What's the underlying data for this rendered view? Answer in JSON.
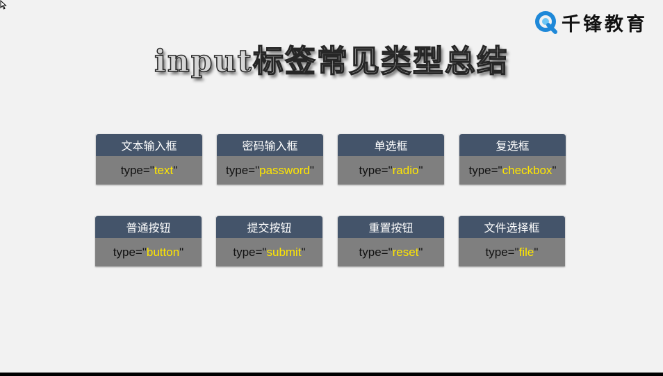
{
  "logo": {
    "text": "千锋教育",
    "icon": "qianfeng-q-logo-icon"
  },
  "title": "input标签常见类型总结",
  "cards": [
    {
      "label": "文本输入框",
      "prefix": "type=\"",
      "value": "text",
      "suffix": "\""
    },
    {
      "label": "密码输入框",
      "prefix": "type=\"",
      "value": "password",
      "suffix": "\""
    },
    {
      "label": "单选框",
      "prefix": "type=\"",
      "value": "radio",
      "suffix": "\""
    },
    {
      "label": "复选框",
      "prefix": "type=\"",
      "value": "checkbox",
      "suffix": "\""
    },
    {
      "label": "普通按钮",
      "prefix": "type=\"",
      "value": "button",
      "suffix": "\""
    },
    {
      "label": "提交按钮",
      "prefix": "type=\"",
      "value": "submit",
      "suffix": "\""
    },
    {
      "label": "重置按钮",
      "prefix": "type=\"",
      "value": "reset",
      "suffix": "\""
    },
    {
      "label": "文件选择框",
      "prefix": "type=\"",
      "value": "file",
      "suffix": "\""
    }
  ],
  "colors": {
    "background": "#f2f2f2",
    "card_header": "#44546a",
    "card_body": "#7f7f7f",
    "value_highlight": "#ffe600",
    "logo_blue": "#1e88d8"
  }
}
